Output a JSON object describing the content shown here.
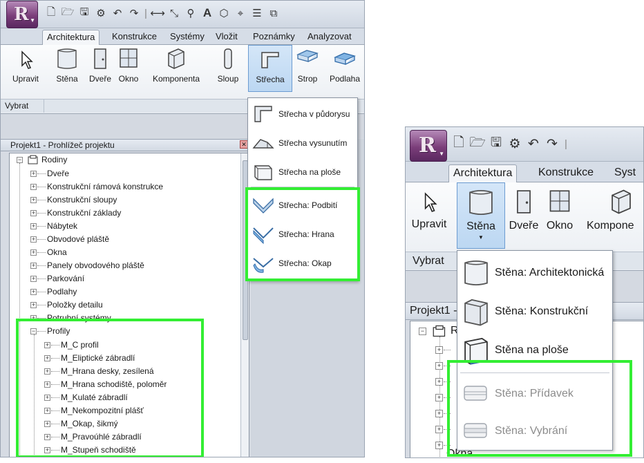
{
  "left": {
    "tabs": [
      "Architektura",
      "Konstrukce",
      "Systémy",
      "Vložit",
      "Poznámky",
      "Analyzovat"
    ],
    "ribbon": [
      "Upravit",
      "Stěna",
      "Dveře",
      "Okno",
      "Komponenta",
      "Sloup",
      "Střecha",
      "Strop",
      "Podlaha"
    ],
    "panel_label": "Vybrat",
    "browser_title": "Projekt1 - Prohlížeč projektu",
    "tree": {
      "root": "Rodiny",
      "families": [
        "Dveře",
        "Konstrukční rámová konstrukce",
        "Konstrukční sloupy",
        "Konstrukční základy",
        "Nábytek",
        "Obvodové pláště",
        "Okna",
        "Panely obvodového pláště",
        "Parkování",
        "Podlahy",
        "Položky detailu",
        "Potrubní systémy"
      ],
      "profiles_label": "Profily",
      "profiles": [
        "M_C profil",
        "M_Eliptické zábradlí",
        "M_Hrana desky, zesílená",
        "M_Hrana schodiště, poloměr",
        "M_Kulaté zábradlí",
        "M_Nekompozitní plášť",
        "M_Okap, šikmý",
        "M_Pravoúhlé zábradlí",
        "M_Stupeň schodiště"
      ]
    },
    "roof_menu": [
      "Střecha v půdorysu",
      "Střecha vysunutím",
      "Střecha na ploše",
      "Střecha: Podbití",
      "Střecha: Hrana",
      "Střecha: Okap"
    ]
  },
  "right": {
    "tabs": [
      "Architektura",
      "Konstrukce",
      "Syst"
    ],
    "ribbon": [
      "Upravit",
      "Stěna",
      "Dveře",
      "Okno",
      "Kompone"
    ],
    "panel_label": "Vybrat",
    "browser_title": "Projekt1 -",
    "tree_visible": [
      "R",
      "Okna"
    ],
    "wall_menu": [
      "Stěna: Architektonická",
      "Stěna: Konstrukční",
      "Stěna na ploše",
      "Stěna: Přídavek",
      "Stěna: Vybrání"
    ]
  },
  "colors": {
    "highlight": "#33ee33",
    "pressed": "#bcd7f2",
    "app_button": "#7b3e7a"
  }
}
